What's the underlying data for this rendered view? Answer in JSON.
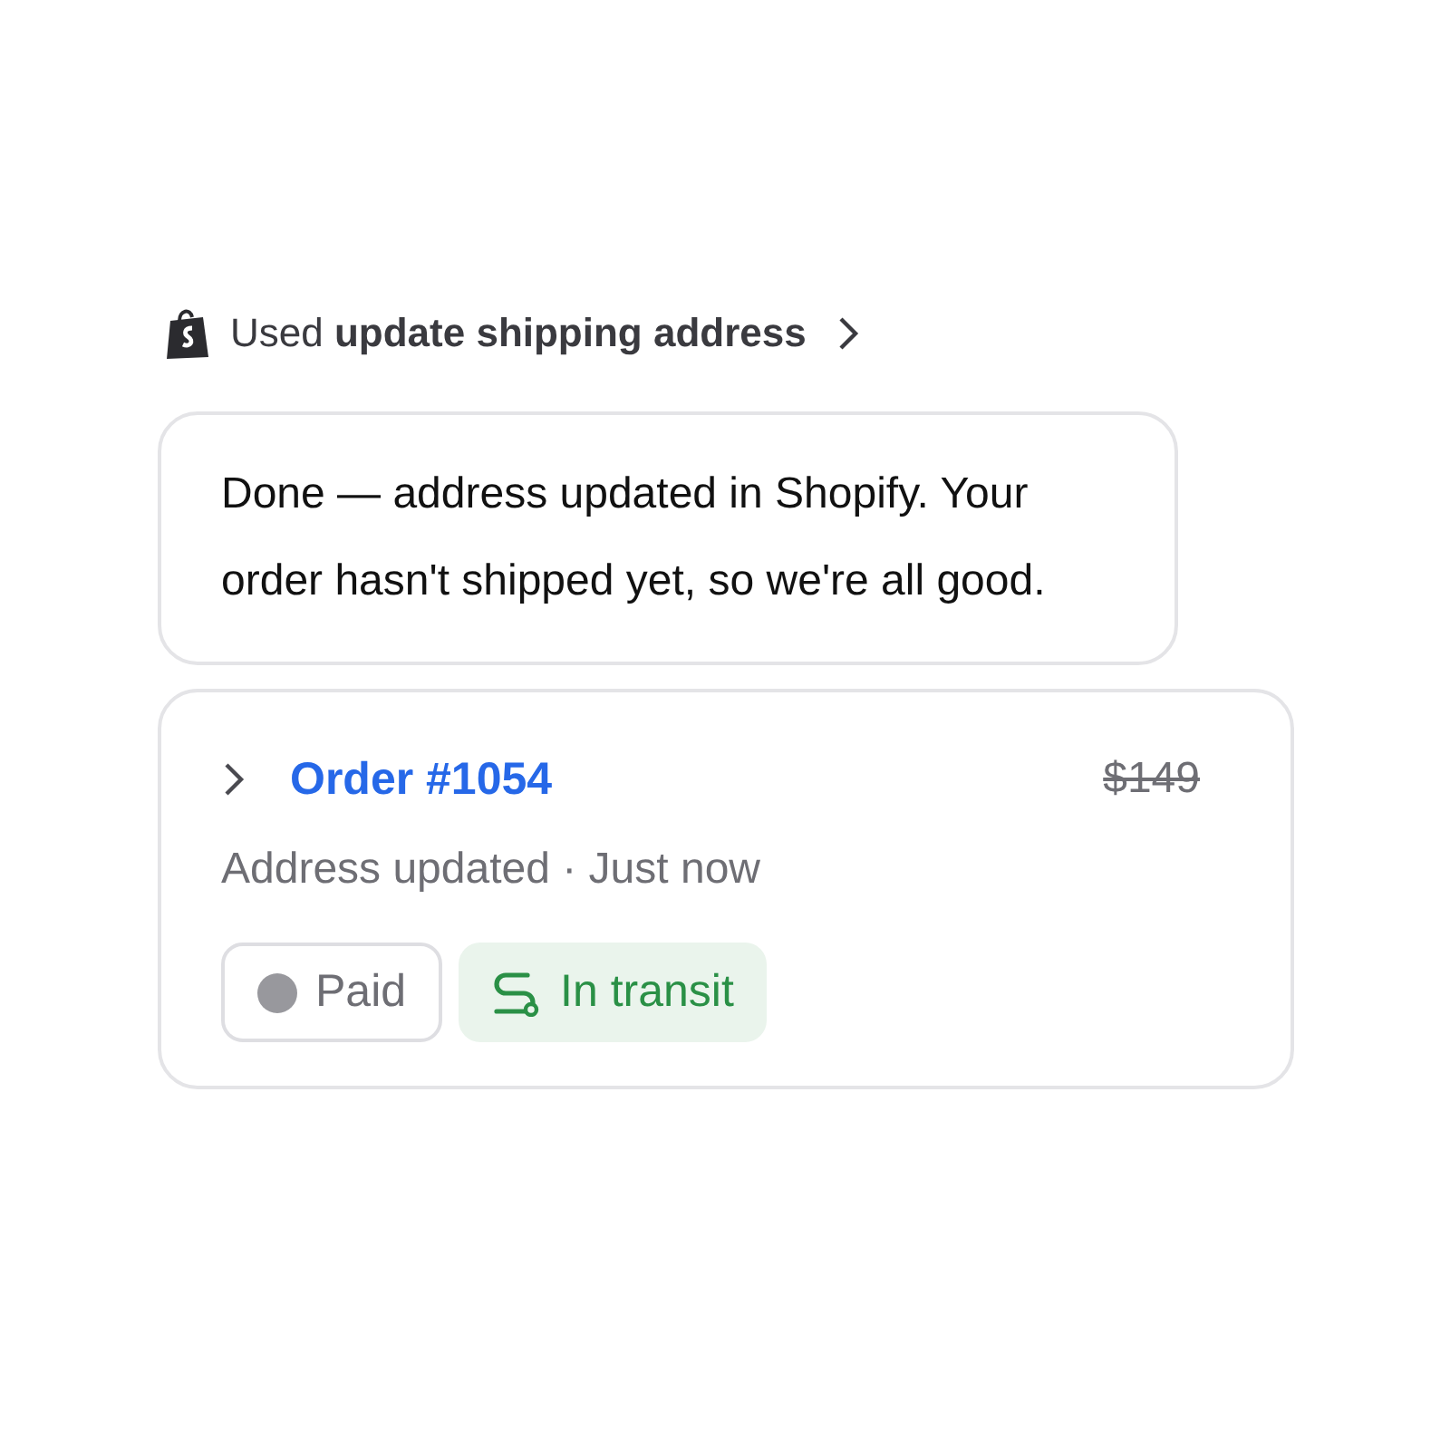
{
  "tool_call": {
    "label": "Used **update shipping address**"
  },
  "message": {
    "text": "Done — address updated in Shopify. Your order hasn't shipped yet, so we're all good."
  },
  "order_card": {
    "expanded": false,
    "title": "Order #1054",
    "price": "$149",
    "price_struck": true,
    "subtitle": "Address updated · Just now",
    "badges": [
      {
        "kind": "dot",
        "label": "Paid",
        "color": "#98989d"
      },
      {
        "kind": "transit",
        "label": "In transit",
        "color": "#2a9046"
      }
    ]
  }
}
